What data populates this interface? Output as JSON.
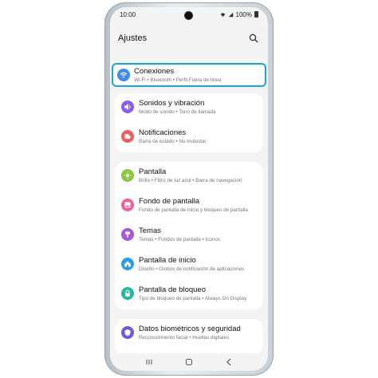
{
  "status": {
    "time": "10:00",
    "battery": "100%"
  },
  "header": {
    "title": "Ajustes",
    "search_icon": "search-icon"
  },
  "colors": {
    "highlight": "#1aa6d0",
    "conexiones": "#3f8bf0",
    "sonidos": "#8a5cf5",
    "notificaciones": "#ef5e5e",
    "pantalla": "#8cc63f",
    "fondo": "#ee5f9a",
    "temas": "#a55bd9",
    "inicio": "#2f9de6",
    "bloqueo": "#29b6a4",
    "biometricos": "#6a5be8"
  },
  "items": [
    {
      "key": "conexiones",
      "name": "Conexiones",
      "sub": "Wi-Fi  •  Bluetooth  •  Perfil Fuera de línea",
      "icon": "wifi-icon"
    },
    {
      "key": "sonidos",
      "name": "Sonidos y vibración",
      "sub": "Modo de sonido  •  Tono de llamada",
      "icon": "volume-icon"
    },
    {
      "key": "notificaciones",
      "name": "Notificaciones",
      "sub": "Barra de estado  •  No molestar",
      "icon": "bell-icon"
    },
    {
      "key": "pantalla",
      "name": "Pantalla",
      "sub": "Brillo  •  Filtro de luz azul  •  Barra de navegación",
      "icon": "brightness-icon"
    },
    {
      "key": "fondo",
      "name": "Fondo de pantalla",
      "sub": "Fondo de pantalla de inicio y bloqueo de pantalla",
      "icon": "image-icon"
    },
    {
      "key": "temas",
      "name": "Temas",
      "sub": "Temas  •  Fondos de pantalla  •  Íconos",
      "icon": "brush-icon"
    },
    {
      "key": "inicio",
      "name": "Pantalla de inicio",
      "sub": "Diseño  •  Globos de notificación de aplicaciones",
      "icon": "home-icon"
    },
    {
      "key": "bloqueo",
      "name": "Pantalla de bloqueo",
      "sub": "Tipo de bloqueo de pantalla  •  Always On Display",
      "icon": "lock-icon"
    },
    {
      "key": "biometricos",
      "name": "Datos biométricos y seguridad",
      "sub": "Reconocimiento facial  •  Huellas digitales",
      "icon": "shield-icon"
    }
  ],
  "navbar": {
    "recent": "recent-apps-icon",
    "home": "home-button-icon",
    "back": "back-icon"
  }
}
